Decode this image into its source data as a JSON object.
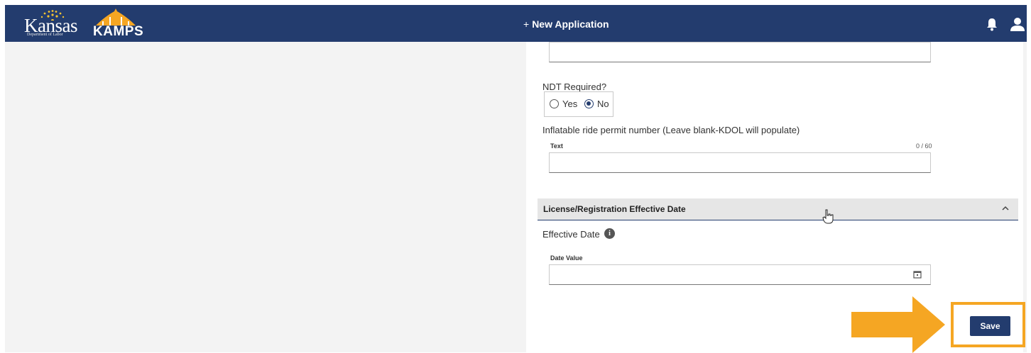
{
  "header": {
    "logo_word": "Kansas",
    "logo_sub": "Department of Labor",
    "app_logo": "KAMPS",
    "new_application_plus": "+",
    "new_application_label": "New Application",
    "icons": [
      "bell-icon",
      "user-icon"
    ]
  },
  "form": {
    "ndt_label": "NDT Required?",
    "ndt_options": [
      "Yes",
      "No"
    ],
    "ndt_selected": "No",
    "permit_label": "Inflatable ride permit number (Leave blank-KDOL will populate)",
    "permit_field_label": "Text",
    "permit_counter": "0 / 60",
    "permit_value": ""
  },
  "section": {
    "title": "License/Registration Effective Date",
    "effective_date_label": "Effective Date",
    "date_field_label": "Date Value",
    "date_value": ""
  },
  "actions": {
    "save_label": "Save"
  },
  "colors": {
    "navy": "#233c6e",
    "highlight": "#f5a623",
    "background": "#f3f3f3"
  }
}
